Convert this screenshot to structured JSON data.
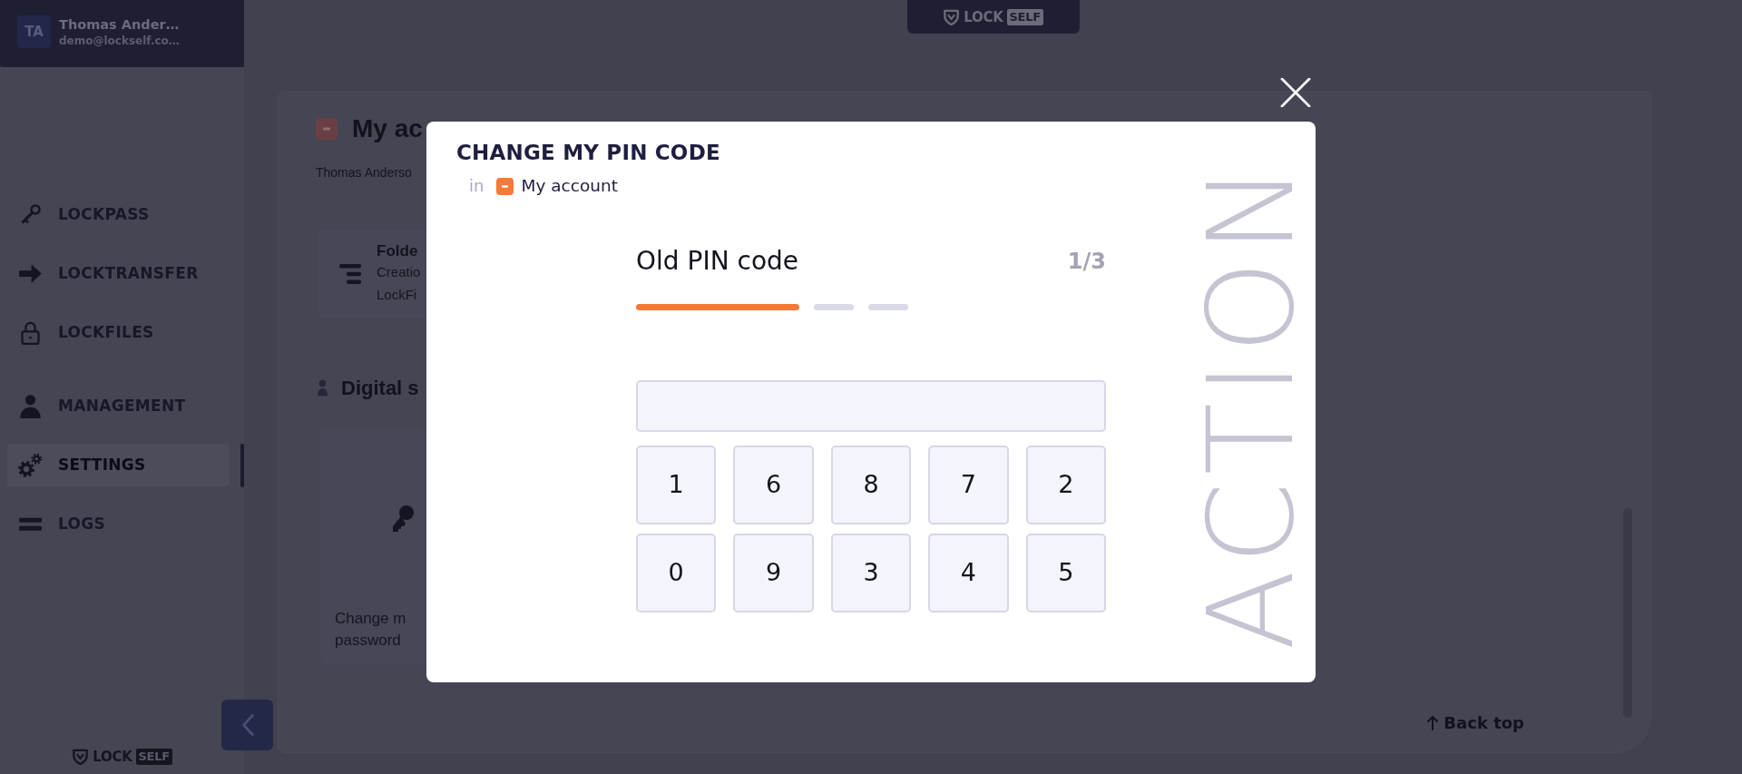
{
  "sidebar": {
    "user": {
      "initials": "TA",
      "name": "Thomas Ander…",
      "email": "demo@lockself.co…"
    },
    "sections": [
      {
        "items": [
          {
            "label": "LOCKPASS",
            "selected": false
          },
          {
            "label": "LOCKTRANSFER",
            "selected": false
          },
          {
            "label": "LOCKFILES",
            "selected": false
          }
        ]
      },
      {
        "items": [
          {
            "label": "MANAGEMENT",
            "selected": false
          },
          {
            "label": "SETTINGS",
            "selected": true
          },
          {
            "label": "LOGS",
            "selected": false
          }
        ]
      }
    ],
    "logo": {
      "text_1": "LOCK",
      "text_2": "SELF"
    }
  },
  "header_logo": {
    "text_1": "LOCK",
    "text_2": "SELF"
  },
  "page": {
    "title": "My ac",
    "subtitle": "Thomas Anderso",
    "folder_card": {
      "title": "Folde",
      "lines": [
        "Creatio",
        "LockFi"
      ]
    },
    "section_title": "Digital s",
    "action_card": {
      "lines": [
        "Change m",
        "password"
      ]
    },
    "back_top": "Back top"
  },
  "modal": {
    "title": "CHANGE MY PIN CODE",
    "breadcrumb": {
      "prefix": "in",
      "label": "My account"
    },
    "watermark": "ACTION",
    "step_title": "Old PIN code",
    "step_counter": "1/3",
    "steps": [
      {
        "active": true
      },
      {
        "active": false
      },
      {
        "active": false
      }
    ],
    "keypad": [
      "1",
      "6",
      "8",
      "7",
      "2",
      "0",
      "9",
      "3",
      "4",
      "5"
    ]
  }
}
